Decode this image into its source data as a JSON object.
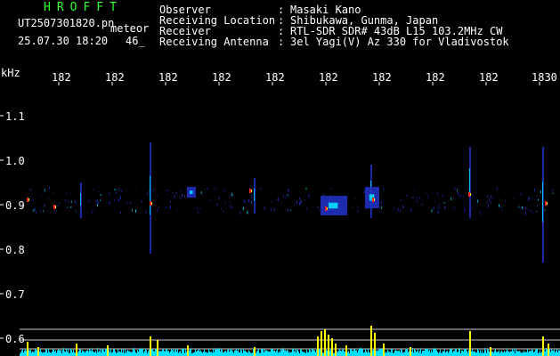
{
  "header": {
    "brand": "HROFFT",
    "file_name": "UT2507301820.pn",
    "mode": "meteor",
    "datetime": "25.07.30 18:20",
    "count": "46_",
    "fields": [
      {
        "label": "Observer",
        "sep": ":",
        "value": "Masaki Kano"
      },
      {
        "label": "Receiving Location",
        "sep": ":",
        "value": "Shibukawa, Gunma, Japan"
      },
      {
        "label": "Receiver",
        "sep": ":",
        "value": "RTL-SDR SDR# 43dB L15 103.2MHz CW"
      },
      {
        "label": "Receiving Antenna",
        "sep": ":",
        "value": "3el Yagi(V) Az 330 for Vladivostok"
      }
    ]
  },
  "axes": {
    "y_unit": "kHz",
    "y_ticks": [
      "1.1",
      "1.0",
      "0.9",
      "0.8",
      "0.7",
      "0.6"
    ],
    "x_ticks": [
      "182",
      "182",
      "182",
      "182",
      "182",
      "182",
      "182",
      "182",
      "182",
      "1830"
    ]
  },
  "colors": {
    "background": "#000000",
    "brand_green": "#30ff30",
    "signal_blue": "#2030c0",
    "signal_cyan": "#00e0ff",
    "signal_yellow": "#ffff00",
    "signal_red": "#ff2020"
  }
}
